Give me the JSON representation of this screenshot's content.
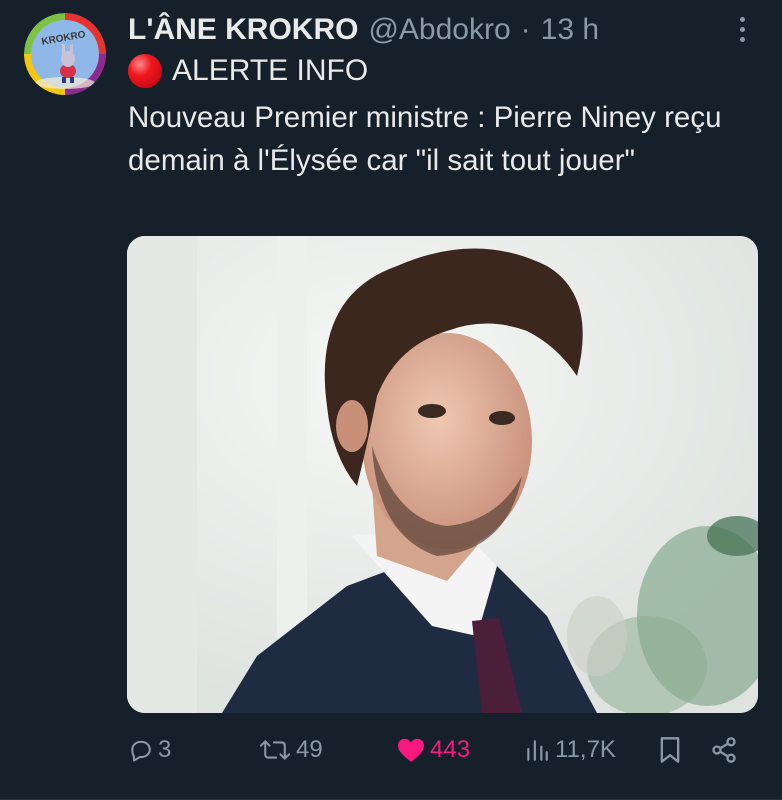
{
  "tweet": {
    "author_name": "L'ÂNE KROKRO",
    "handle": "@Abdokro",
    "separator": "·",
    "time": "13 h",
    "avatar_text": "KROKRO",
    "alert_label": "ALERTE INFO",
    "body": "Nouveau Premier ministre : Pierre Niney reçu demain à l'Élysée car \"il sait tout jouer\""
  },
  "actions": {
    "replies": "3",
    "retweets": "49",
    "likes": "443",
    "views": "11,7K"
  },
  "colors": {
    "background": "#15202b",
    "secondary_text": "#8b98a5",
    "like": "#f91880",
    "alert_dot": "#f1181e"
  },
  "icons": [
    "more-icon",
    "alert-dot-icon",
    "reply-icon",
    "retweet-icon",
    "heart-icon",
    "views-icon",
    "bookmark-icon",
    "share-icon"
  ]
}
